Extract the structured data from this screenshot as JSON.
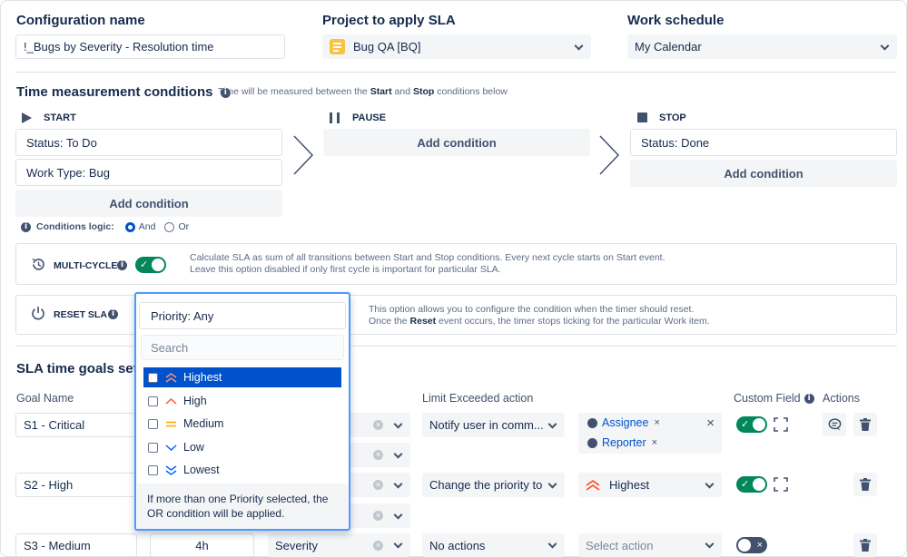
{
  "header": {
    "config_label": "Configuration name",
    "config_value": "!_Bugs by Severity - Resolution time",
    "project_label": "Project to apply SLA",
    "project_value": "Bug QA [BQ]",
    "schedule_label": "Work schedule",
    "schedule_value": "My Calendar"
  },
  "time_conditions": {
    "title": "Time measurement conditions",
    "note_pre": "Time will be measured between the ",
    "note_start": "Start",
    "note_mid": " and ",
    "note_stop": "Stop",
    "note_post": " conditions below",
    "start": {
      "label": "START",
      "conditions": [
        "Status: To Do",
        "Work Type: Bug"
      ],
      "add": "Add condition"
    },
    "pause": {
      "label": "PAUSE",
      "add": "Add condition"
    },
    "stop": {
      "label": "STOP",
      "conditions": [
        "Status: Done"
      ],
      "add": "Add condition"
    },
    "logic_label": "Conditions logic:",
    "logic_and": "And",
    "logic_or": "Or"
  },
  "multi_cycle": {
    "label": "MULTI-CYCLE",
    "desc1": "Calculate SLA as sum of all transitions between Start and Stop conditions. Every next cycle starts on Start event.",
    "desc2": "Leave this option disabled if only first cycle is important for particular SLA."
  },
  "reset_sla": {
    "label": "RESET SLA",
    "desc1": "This option allows you to configure the condition when the timer should reset.",
    "desc2_pre": "Once the ",
    "desc2_bold": "Reset",
    "desc2_post": " event occurs, the timer stops ticking for the particular Work item."
  },
  "priority_dropdown": {
    "value": "Priority: Any",
    "search_placeholder": "Search",
    "options": [
      "Highest",
      "High",
      "Medium",
      "Low",
      "Lowest"
    ],
    "footer": "If more than one Priority selected, the OR condition will be applied."
  },
  "goals": {
    "title": "SLA time goals setting",
    "col_goal": "Goal Name",
    "col_limit": "Limit Exceeded action",
    "col_custom": "Custom Field",
    "col_actions": "Actions",
    "rows": [
      {
        "name": "S1 - Critical",
        "action": "Notify user in comm...",
        "tags": [
          "Assignee",
          "Reporter"
        ]
      },
      {
        "name": "S2 - High",
        "action": "Change the priority to",
        "target": "Highest"
      },
      {
        "name": "S3 - Medium",
        "time": "4h",
        "field": "Severity",
        "action": "No actions",
        "target_placeholder": "Select action"
      }
    ]
  },
  "colors": {
    "accent": "#0052cc",
    "toggle_on": "#00875a",
    "focus": "#4c9aff"
  }
}
